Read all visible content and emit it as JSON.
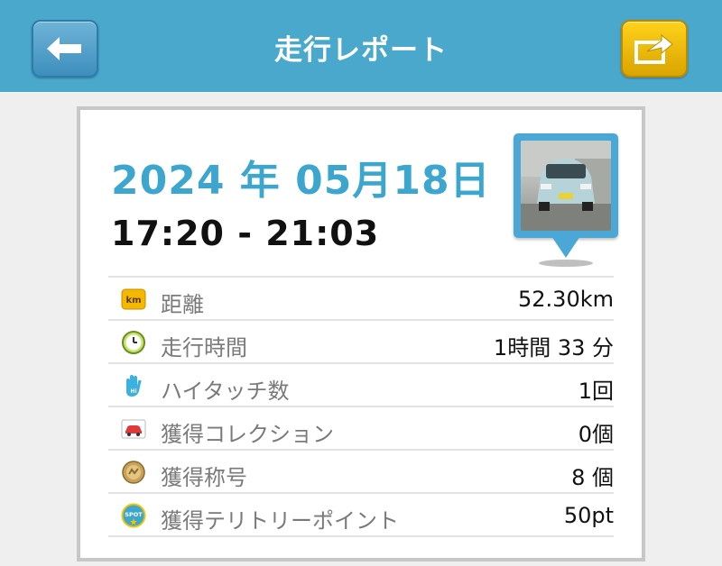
{
  "header": {
    "title": "走行レポート",
    "background": "#4aa8cc"
  },
  "report": {
    "date": "2024 年 05月18日",
    "time_range": "17:20 - 21:03"
  },
  "stats": [
    {
      "icon": "km-badge-icon",
      "label": "距離",
      "value": "52.30km"
    },
    {
      "icon": "clock-icon",
      "label": "走行時間",
      "value": "1時間 33 分"
    },
    {
      "icon": "hand-icon",
      "label": "ハイタッチ数",
      "value": "1回"
    },
    {
      "icon": "car-icon",
      "label": "獲得コレクション",
      "value": "0個"
    },
    {
      "icon": "medal-icon",
      "label": "獲得称号",
      "value": "8 個"
    },
    {
      "icon": "spot-badge-icon",
      "label": "獲得テリトリーポイント",
      "value": "50pt"
    }
  ],
  "colors": {
    "accent": "#3ca6cf",
    "share": "#f5c400"
  }
}
